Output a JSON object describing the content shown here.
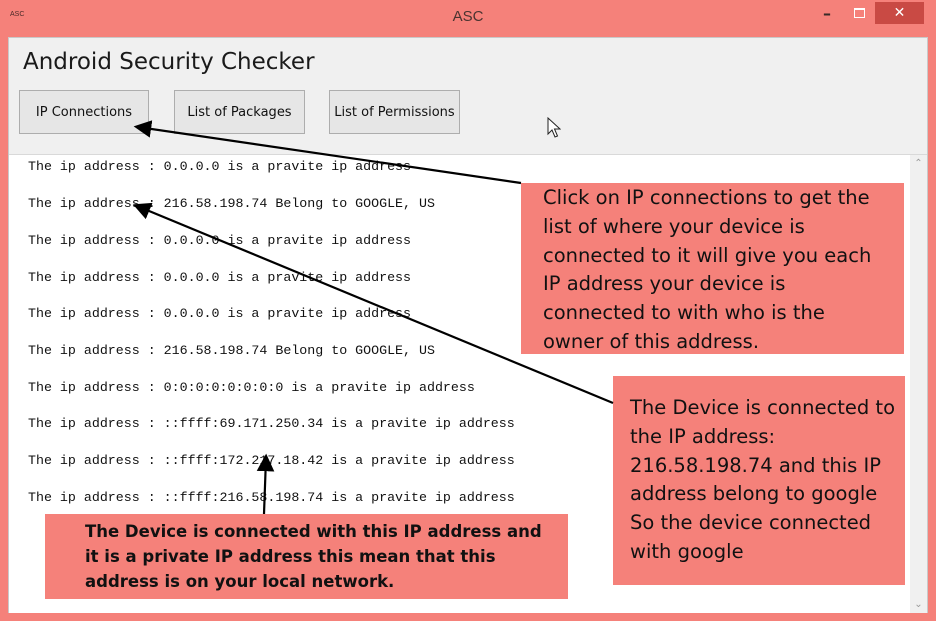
{
  "window": {
    "app_icon_label": "ASC",
    "title": "ASC",
    "controls": {
      "minimize": "–",
      "close": "✕"
    }
  },
  "app": {
    "heading": "Android Security Checker",
    "buttons": {
      "ip_connections": "IP Connections",
      "list_of_packages": "List of Packages",
      "list_of_permissions": "List of Permissions"
    }
  },
  "output_lines": [
    "The ip address : 0.0.0.0 is a pravite ip address",
    "The ip address : 216.58.198.74 Belong to GOOGLE, US",
    "The ip address : 0.0.0.0 is a pravite ip address",
    "The ip address : 0.0.0.0 is a pravite ip address",
    "The ip address : 0.0.0.0 is a pravite ip address",
    "The ip address : 216.58.198.74 Belong to GOOGLE, US",
    "The ip address : 0:0:0:0:0:0:0:0 is a pravite ip address",
    "The ip address : ::ffff:69.171.250.34 is a pravite ip address",
    "The ip address : ::ffff:172.217.18.42 is a pravite ip address",
    "The ip address : ::ffff:216.58.198.74 is a pravite ip address"
  ],
  "callouts": {
    "ip_connections_hint": "Click on IP connections to get the list of where your device is connected to it will give you each IP address your device is connected to with who is the owner of this address.",
    "google_connection": "The Device is connected to the IP address: 216.58.198.74 and this IP address belong to google So the device connected with google",
    "private_ip": "The Device is connected with this IP address and it is a private IP address this mean that this address is on your local network."
  },
  "scrollbar": {
    "up_arrow": "⌃",
    "down_arrow": "⌄"
  },
  "colors": {
    "frame": "#f5817a",
    "close_button": "#c94a44",
    "client_bg": "#f0f0f0",
    "output_bg": "#ffffff",
    "callout_bg": "#f5817a"
  }
}
